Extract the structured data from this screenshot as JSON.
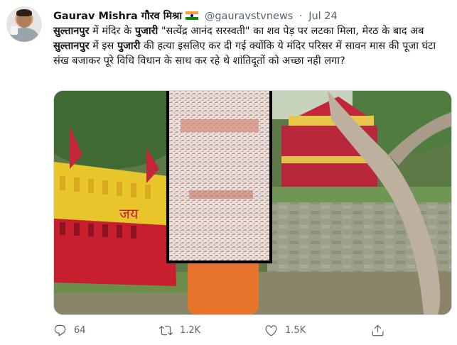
{
  "author": {
    "display_name": "Gaurav Mishra गौरव मिश्रा",
    "handle": "@gauravstvnews",
    "separator": "·",
    "date": "Jul 24"
  },
  "tweet": {
    "segments": [
      {
        "text": "सुल्तानपुर",
        "bold": true
      },
      {
        "text": " में मंदिर के ",
        "bold": false
      },
      {
        "text": "पुजारी",
        "bold": true
      },
      {
        "text": " \"सत्येंद्र आनंद सरस्वती\" का शव पेड़ पर लटका मिला, मेरठ के बाद अब ",
        "bold": false
      },
      {
        "text": "सुल्तानपुर",
        "bold": true
      },
      {
        "text": " में इस ",
        "bold": false
      },
      {
        "text": "पुजारी",
        "bold": true
      },
      {
        "text": " की हत्या इसलिए कर दी गई क्योंकि ये मंदिर परिसर में सावन मास की पूजा घंटा संख बजाकर पूरे विधि विधान के साथ कर रहे थे शांतिदूतों को अच्छा नही लगा?",
        "bold": false
      }
    ]
  },
  "media": {
    "wall_text": "जय"
  },
  "actions": {
    "reply": {
      "icon": "reply-icon",
      "count": "64"
    },
    "retweet": {
      "icon": "retweet-icon",
      "count": "1.2K"
    },
    "like": {
      "icon": "like-icon",
      "count": "1.5K"
    },
    "share": {
      "icon": "share-icon"
    }
  },
  "colors": {
    "text": "#0f1419",
    "secondary": "#536471",
    "wall_yellow": "#e9c52c",
    "wall_red": "#c71f2e"
  }
}
